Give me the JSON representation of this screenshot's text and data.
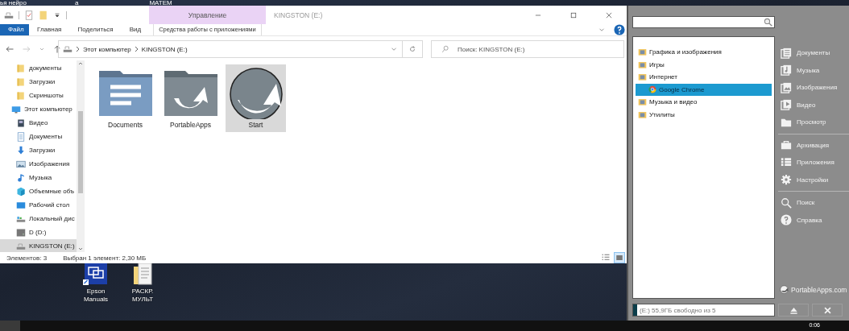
{
  "desktop": {
    "top_labels": [
      "ья нейро",
      "а",
      "МАТЕМ"
    ],
    "icons": [
      {
        "label": "Epson Manuals",
        "kind": "epson"
      },
      {
        "label": "РАСКР. МУЛЬТ",
        "kind": "document"
      }
    ]
  },
  "explorer": {
    "title": "KINGSTON (E:)",
    "context_group": "Управление",
    "ribbon_tabs": [
      {
        "label": "Файл",
        "kind": "file"
      },
      {
        "label": "Главная",
        "kind": "tab"
      },
      {
        "label": "Поделиться",
        "kind": "tab"
      },
      {
        "label": "Вид",
        "kind": "tab"
      },
      {
        "label": "Средства работы с приложениями",
        "kind": "context"
      }
    ],
    "breadcrumb": [
      "Этот компьютер",
      "KINGSTON (E:)"
    ],
    "search": {
      "placeholder": "Поиск: KINGSTON (E:)"
    },
    "nav": [
      {
        "label": "документы",
        "kind": "folder",
        "selected": false
      },
      {
        "label": "Загрузки",
        "kind": "folder",
        "selected": false
      },
      {
        "label": "Скриншоты",
        "kind": "folder",
        "selected": false
      },
      {
        "label": "Этот компьютер",
        "kind": "pc",
        "selected": false,
        "children": [
          {
            "label": "Видео",
            "kind": "video",
            "selected": false
          },
          {
            "label": "Документы",
            "kind": "docs",
            "selected": false
          },
          {
            "label": "Загрузки",
            "kind": "download",
            "selected": false
          },
          {
            "label": "Изображения",
            "kind": "images",
            "selected": false
          },
          {
            "label": "Музыка",
            "kind": "music",
            "selected": false
          },
          {
            "label": "Объемные объ",
            "kind": "cube",
            "selected": false
          },
          {
            "label": "Рабочий стол",
            "kind": "desktop",
            "selected": false
          },
          {
            "label": "Локальный дис",
            "kind": "localdisk",
            "selected": false
          },
          {
            "label": "D (D:)",
            "kind": "drive",
            "selected": false
          },
          {
            "label": "KINGSTON (E:)",
            "kind": "usb",
            "selected": true
          }
        ]
      }
    ],
    "files": [
      {
        "name": "Documents",
        "kind": "documents",
        "selected": false
      },
      {
        "name": "PortableApps",
        "kind": "portableapps",
        "selected": false
      },
      {
        "name": "Start",
        "kind": "start",
        "selected": true
      }
    ],
    "status": [
      "Элементов: 3",
      "Выбран 1 элемент: 2,30 МБ"
    ],
    "view_buttons": [
      {
        "kind": "details",
        "selected": false
      },
      {
        "kind": "icons",
        "selected": true
      }
    ]
  },
  "portable_menu": {
    "tree": [
      {
        "label": "Графика и изображения",
        "selected": false
      },
      {
        "label": "Игры",
        "selected": false
      },
      {
        "label": "Интернет",
        "selected": false,
        "children": [
          {
            "label": "Google Chrome",
            "selected": true
          }
        ]
      },
      {
        "label": "Музыка и видео",
        "selected": false
      },
      {
        "label": "Утилиты",
        "selected": false
      }
    ],
    "link_groups": [
      [
        {
          "label": "Документы",
          "kind": "documents"
        },
        {
          "label": "Музыка",
          "kind": "music"
        },
        {
          "label": "Изображения",
          "kind": "images"
        },
        {
          "label": "Видео",
          "kind": "video"
        },
        {
          "label": "Просмотр",
          "kind": "browse"
        }
      ],
      [
        {
          "label": "Архивация",
          "kind": "backup"
        },
        {
          "label": "Приложения",
          "kind": "apps"
        },
        {
          "label": "Настройки",
          "kind": "settings"
        }
      ],
      [
        {
          "label": "Поиск",
          "kind": "search"
        },
        {
          "label": "Справка",
          "kind": "help"
        }
      ]
    ],
    "brand": "PortableApps.com",
    "disk": {
      "text": "(E:) 55,9ГБ свободно из 5",
      "level": 0.03
    }
  },
  "taskbar": {
    "time": "0:06"
  }
}
